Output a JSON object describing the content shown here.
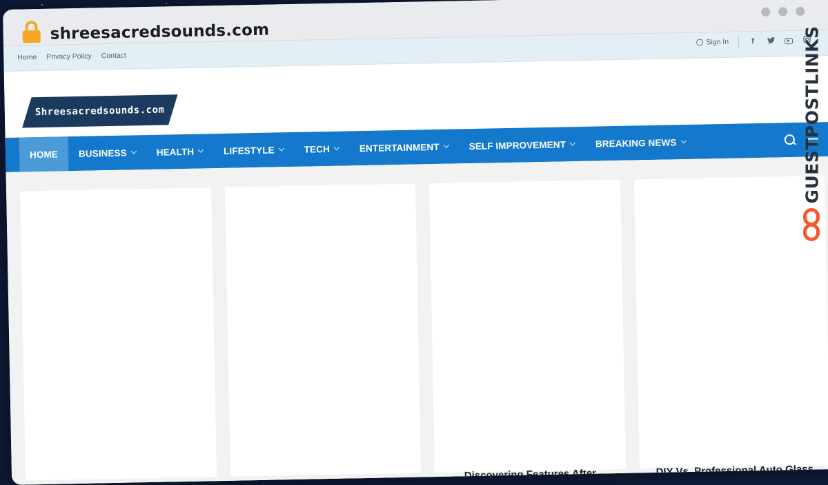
{
  "browser": {
    "url": "shreesacredsounds.com"
  },
  "topbar": {
    "links": [
      "Home",
      "Privacy Policy",
      "Contact"
    ],
    "signin": "Sign In",
    "social": [
      "f",
      "𝕏",
      "youtube",
      "instagram"
    ]
  },
  "header": {
    "logo_text": "Shreesacredsounds.com"
  },
  "nav": {
    "items": [
      "HOME",
      "BUSINESS",
      "HEALTH",
      "LIFESTYLE",
      "TECH",
      "ENTERTAINMENT",
      "SELF IMPROVEMENT",
      "BREAKING NEWS"
    ]
  },
  "cards": [
    {
      "title": ""
    },
    {
      "title": ""
    },
    {
      "title": "Discovering Features After"
    },
    {
      "title": "DIY Vs. Professional Auto Glass"
    }
  ],
  "watermark": {
    "text": "GUESTPOSTLINKS"
  },
  "colors": {
    "nav": "#1479cc",
    "nav_active": "#4a9bd8",
    "logo_bg": "#1b3a5e",
    "accent": "#f25a2a"
  }
}
